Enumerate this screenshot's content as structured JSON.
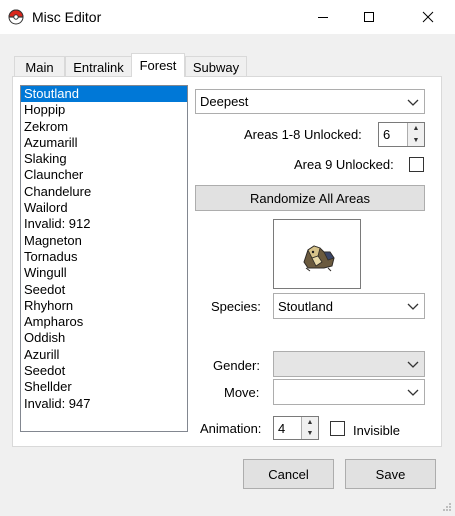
{
  "window": {
    "title": "Misc Editor",
    "app_icon": "pokeball-icon",
    "controls": [
      "minimize-icon",
      "maximize-icon",
      "close-icon"
    ]
  },
  "tabs": [
    {
      "label": "Main",
      "active": false
    },
    {
      "label": "Entralink",
      "active": false
    },
    {
      "label": "Forest",
      "active": true
    },
    {
      "label": "Subway",
      "active": false
    }
  ],
  "forest": {
    "pokemon_list": [
      {
        "label": "Stoutland",
        "selected": true
      },
      {
        "label": "Hoppip"
      },
      {
        "label": "Zekrom"
      },
      {
        "label": "Azumarill"
      },
      {
        "label": "Slaking"
      },
      {
        "label": "Clauncher"
      },
      {
        "label": "Chandelure"
      },
      {
        "label": "Wailord"
      },
      {
        "label": "Invalid: 912"
      },
      {
        "label": "Magneton"
      },
      {
        "label": "Tornadus"
      },
      {
        "label": "Wingull"
      },
      {
        "label": "Seedot"
      },
      {
        "label": "Rhyhorn"
      },
      {
        "label": "Ampharos"
      },
      {
        "label": "Oddish"
      },
      {
        "label": "Azurill"
      },
      {
        "label": "Seedot"
      },
      {
        "label": "Shellder"
      },
      {
        "label": "Invalid: 947"
      }
    ],
    "area_select": "Deepest",
    "areas_unlocked_label": "Areas 1-8 Unlocked:",
    "areas_unlocked_value": "6",
    "area9_label": "Area 9 Unlocked:",
    "area9_checked": false,
    "randomize_label": "Randomize All Areas",
    "sprite_icon": "stoutland-sprite-icon",
    "species_label": "Species:",
    "species_value": "Stoutland",
    "gender_label": "Gender:",
    "gender_value": "",
    "move_label": "Move:",
    "move_value": "",
    "animation_label": "Animation:",
    "animation_value": "4",
    "invisible_label": "Invisible",
    "invisible_checked": false
  },
  "footer": {
    "cancel_label": "Cancel",
    "save_label": "Save"
  }
}
